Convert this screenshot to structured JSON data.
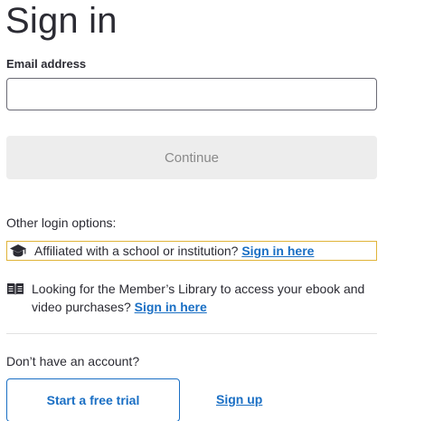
{
  "page": {
    "title": "Sign in"
  },
  "email": {
    "label": "Email address",
    "value": "",
    "placeholder": ""
  },
  "continue_button": {
    "label": "Continue",
    "state": "disabled"
  },
  "other_options": {
    "heading": "Other login options:",
    "school": {
      "icon": "graduation-cap-icon",
      "text": "Affiliated with a school or institution?",
      "link": "Sign in here"
    },
    "library": {
      "icon": "open-book-icon",
      "text": "Looking for the Member’s Library to access your ebook and video purchases?",
      "link": "Sign in here"
    }
  },
  "signup": {
    "prompt": "Don’t have an account?",
    "trial_button": "Start a free trial",
    "signup_link": "Sign up"
  },
  "colors": {
    "link": "#1a6fc4",
    "focus_outline": "#e0b43a",
    "disabled_bg": "#ededed"
  }
}
